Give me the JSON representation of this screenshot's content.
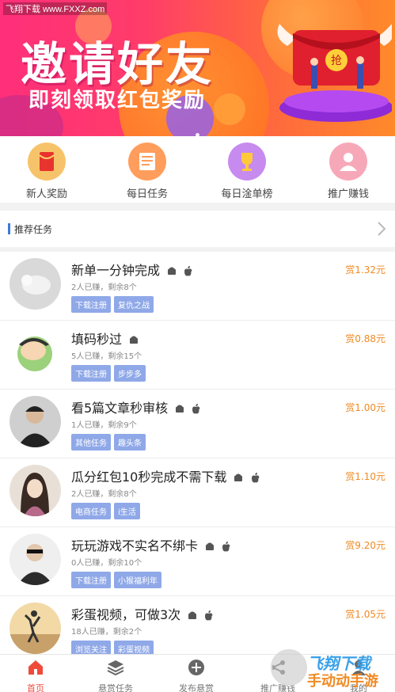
{
  "watermark_top": "飞翔下载 www.FXXZ.com",
  "banner": {
    "title": "邀请好友",
    "subtitle": "即刻领取红包奖励",
    "envelope_label": "抢"
  },
  "quicknav": [
    {
      "label": "新人奖励",
      "icon": "red-envelope-icon"
    },
    {
      "label": "每日任务",
      "icon": "list-icon"
    },
    {
      "label": "每日淦单榜",
      "icon": "trophy-icon"
    },
    {
      "label": "推广赚钱",
      "icon": "user-money-icon"
    }
  ],
  "section": {
    "title": "推荐任务"
  },
  "tasks": [
    {
      "title": "新单一分钟完成",
      "meta": "2人已赚，剩余8个",
      "tags": [
        "下载注册",
        "复仇之战"
      ],
      "price": "赏1.32元",
      "platforms": [
        "android",
        "apple"
      ]
    },
    {
      "title": "填码秒过",
      "meta": "5人已赚，剩余15个",
      "tags": [
        "下载注册",
        "步步多"
      ],
      "price": "赏0.88元",
      "platforms": [
        "android"
      ]
    },
    {
      "title": "看5篇文章秒审核",
      "meta": "1人已赚，剩余9个",
      "tags": [
        "其他任务",
        "趣头条"
      ],
      "price": "赏1.00元",
      "platforms": [
        "android",
        "apple"
      ]
    },
    {
      "title": "瓜分红包10秒完成不需下载",
      "meta": "2人已赚，剩余8个",
      "tags": [
        "电商任务",
        "i生活"
      ],
      "price": "赏1.10元",
      "platforms": [
        "android",
        "apple"
      ]
    },
    {
      "title": "玩玩游戏不实名不绑卡",
      "meta": "0人已赚，剩余10个",
      "tags": [
        "下载注册",
        "小猴福利年"
      ],
      "price": "赏9.20元",
      "platforms": [
        "android",
        "apple"
      ]
    },
    {
      "title": "彩蛋视频，可做3次",
      "meta": "18人已赚，剩余2个",
      "tags": [
        "浏览关注",
        "彩蛋视频"
      ],
      "price": "赏1.05元",
      "platforms": [
        "android",
        "apple"
      ]
    }
  ],
  "tabbar": [
    {
      "label": "首页",
      "icon": "home-icon",
      "active": true
    },
    {
      "label": "悬赏任务",
      "icon": "layers-icon",
      "active": false
    },
    {
      "label": "发布悬赏",
      "icon": "plus-circle-icon",
      "active": false
    },
    {
      "label": "推广赚钱",
      "icon": "share-icon",
      "active": false
    },
    {
      "label": "我的",
      "icon": "user-icon",
      "active": false
    }
  ],
  "watermark_bottom": {
    "line1": "飞翔下载",
    "line2": "手动动手游"
  },
  "colors": {
    "accent": "#f04a3a",
    "price": "#f08a24",
    "tag": "#8fa8e8",
    "section_bar": "#3b7bd8"
  }
}
